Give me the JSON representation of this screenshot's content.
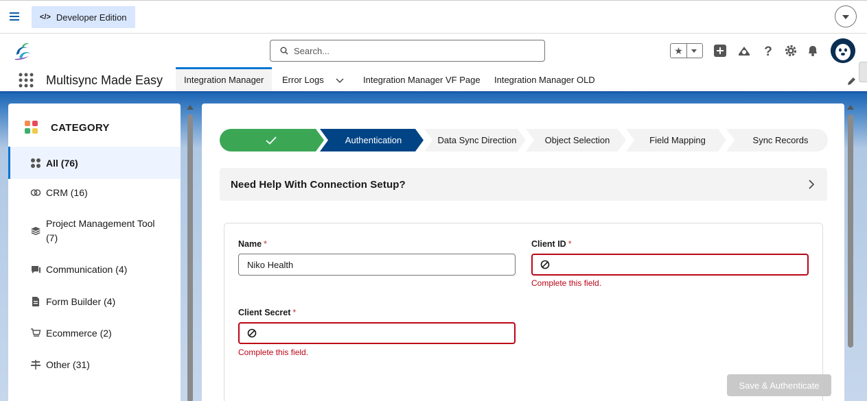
{
  "topbar": {
    "badge_code": "</>",
    "badge_label": "Developer Edition"
  },
  "header": {
    "search_placeholder": "Search..."
  },
  "appnav": {
    "app_name": "Multisync Made Easy",
    "tabs": [
      {
        "label": "Integration Manager",
        "active": true
      },
      {
        "label": "Error Logs",
        "has_menu": true
      },
      {
        "label": "Integration Manager VF Page"
      },
      {
        "label": "Integration Manager OLD"
      }
    ]
  },
  "sidebar": {
    "title": "CATEGORY",
    "items": [
      {
        "label": "All (76)",
        "icon": "grid-icon",
        "active": true
      },
      {
        "label": "CRM (16)",
        "icon": "crm-icon"
      },
      {
        "label": "Project Management Tool (7)",
        "icon": "layers-icon"
      },
      {
        "label": "Communication (4)",
        "icon": "chat-icon"
      },
      {
        "label": "Form Builder (4)",
        "icon": "form-icon"
      },
      {
        "label": "Ecommerce (2)",
        "icon": "cart-icon"
      },
      {
        "label": "Other (31)",
        "icon": "signpost-icon"
      }
    ]
  },
  "path": {
    "steps": [
      {
        "label": "",
        "state": "complete"
      },
      {
        "label": "Authentication",
        "state": "current"
      },
      {
        "label": "Data Sync Direction",
        "state": "incomplete"
      },
      {
        "label": "Object Selection",
        "state": "incomplete"
      },
      {
        "label": "Field Mapping",
        "state": "incomplete"
      },
      {
        "label": "Sync Records",
        "state": "incomplete"
      }
    ]
  },
  "help": {
    "title": "Need Help With Connection Setup?"
  },
  "form": {
    "name_label": "Name",
    "name_value": "Niko Health",
    "client_id_label": "Client ID",
    "client_id_value": "",
    "client_id_error": "Complete this field.",
    "client_secret_label": "Client Secret",
    "client_secret_value": "",
    "client_secret_error": "Complete this field.",
    "required_mark": "*",
    "save_label": "Save & Authenticate"
  },
  "colors": {
    "brand": "#0176d3",
    "path_complete": "#2e844a",
    "path_current": "#014486",
    "error": "#ba0517"
  }
}
